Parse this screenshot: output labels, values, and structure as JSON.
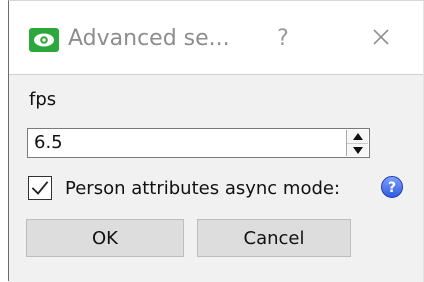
{
  "window": {
    "title": "Advanced se...",
    "help_button": "?",
    "close_icon": "close-icon",
    "app_icon": "eye-icon",
    "accent": "#2ca73b"
  },
  "form": {
    "fps_label": "fps",
    "fps_value": "6.5",
    "checkbox_label": "Person attributes async mode:",
    "checkbox_checked": true,
    "help_icon": "question-circle-icon"
  },
  "actions": {
    "ok": "OK",
    "cancel": "Cancel"
  }
}
